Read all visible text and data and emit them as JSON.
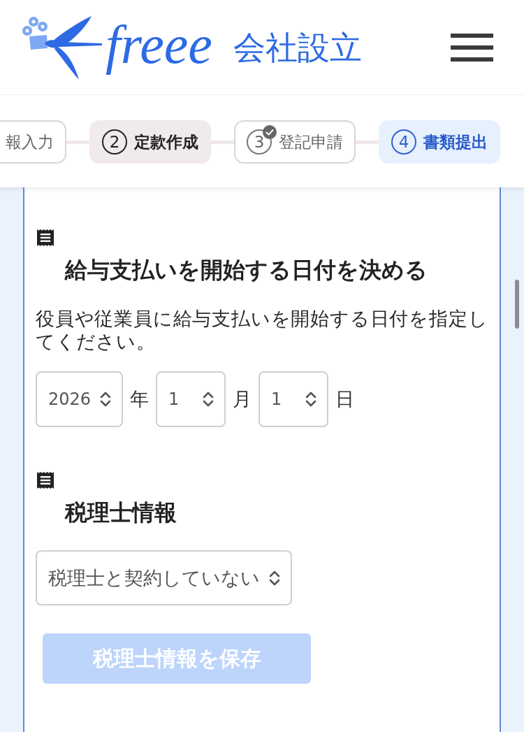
{
  "header": {
    "logo": {
      "wordmark": "freee",
      "product": "会社設立"
    }
  },
  "steps": [
    {
      "label": "報入力",
      "emphasized": false,
      "completed": false,
      "selected": false
    },
    {
      "number": "2",
      "label": "定款作成",
      "emphasized": true,
      "completed": false,
      "selected": false
    },
    {
      "number": "3",
      "label": "登記申請",
      "emphasized": false,
      "completed": true,
      "selected": false
    },
    {
      "number": "4",
      "label": "書類提出",
      "emphasized": false,
      "completed": false,
      "selected": true
    }
  ],
  "sections": [
    {
      "kind": "date",
      "title": "給与支払いを開始する日付を決める",
      "description": "役員や従業員に給与支払いを開始する日付を指定してください。",
      "fields": [
        {
          "value": "2026",
          "unit": "年"
        },
        {
          "value": "1",
          "unit": "月"
        },
        {
          "value": "1",
          "unit": "日"
        }
      ]
    },
    {
      "kind": "select",
      "title": "税理士情報",
      "select": {
        "value": "税理士と契約していない"
      },
      "button": {
        "label": "税理士情報を保存",
        "disabled": true
      }
    }
  ]
}
